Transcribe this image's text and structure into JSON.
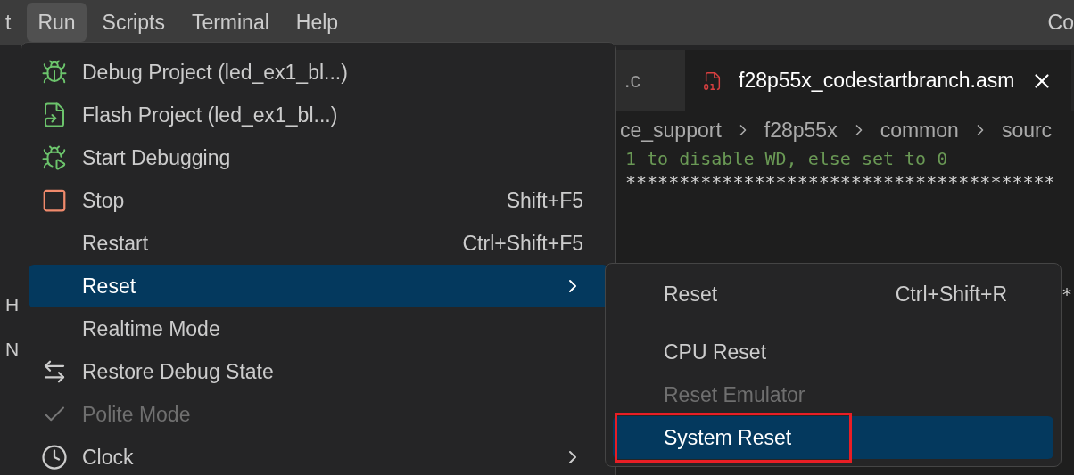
{
  "menu_bar": {
    "items": [
      {
        "label": "t",
        "selected": false
      },
      {
        "label": "Run",
        "selected": true
      },
      {
        "label": "Scripts",
        "selected": false
      },
      {
        "label": "Terminal",
        "selected": false
      },
      {
        "label": "Help",
        "selected": false
      }
    ],
    "title_fragment": "Co"
  },
  "sidebar": {
    "fragments": [
      "H",
      "N"
    ]
  },
  "tabs": [
    {
      "label": ".c",
      "selected": false
    },
    {
      "label": "f28p55x_codestartbranch.asm",
      "selected": true
    }
  ],
  "breadcrumbs": [
    "ce_support",
    "f28p55x",
    "common",
    "sourc"
  ],
  "code_lines": [
    {
      "kind": "comment",
      "text": "1 to disable WD, else set to 0"
    },
    {
      "kind": "plain",
      "text": "****************************************"
    },
    {
      "kind": "tail",
      "text": "*"
    }
  ],
  "run_menu": {
    "items": [
      {
        "label": "Debug Project (led_ex1_bl...)",
        "kind": "debug",
        "submenu": false,
        "selected": false,
        "disabled": false
      },
      {
        "label": "Flash Project (led_ex1_bl...)",
        "kind": "flash",
        "submenu": false,
        "selected": false,
        "disabled": false
      },
      {
        "label": "Start Debugging",
        "kind": "start",
        "submenu": false,
        "selected": false,
        "disabled": false
      },
      {
        "label": "Stop",
        "kind": "stop",
        "shortcut": "Shift+F5",
        "submenu": false,
        "selected": false,
        "disabled": false
      },
      {
        "label": "Restart",
        "kind": "plain",
        "shortcut": "Ctrl+Shift+F5",
        "submenu": false,
        "selected": false,
        "disabled": false
      },
      {
        "label": "Reset",
        "kind": "plain",
        "submenu": true,
        "selected": true,
        "disabled": false
      },
      {
        "label": "Realtime Mode",
        "kind": "plain",
        "submenu": false,
        "selected": false,
        "disabled": false
      },
      {
        "label": "Restore Debug State",
        "kind": "restore",
        "submenu": false,
        "selected": false,
        "disabled": false
      },
      {
        "label": "Polite Mode",
        "kind": "check",
        "submenu": false,
        "selected": false,
        "disabled": true
      },
      {
        "label": "Clock",
        "kind": "clock",
        "submenu": true,
        "selected": false,
        "disabled": false
      }
    ]
  },
  "reset_submenu": {
    "items": [
      {
        "kind": "item",
        "label": "Reset",
        "shortcut": "Ctrl+Shift+R",
        "selected": false,
        "disabled": false
      },
      {
        "kind": "separator"
      },
      {
        "kind": "item",
        "label": "CPU Reset",
        "selected": false,
        "disabled": false
      },
      {
        "kind": "item",
        "label": "Reset Emulator",
        "selected": false,
        "disabled": true
      },
      {
        "kind": "item",
        "label": "System Reset",
        "selected": true,
        "disabled": false
      }
    ]
  },
  "annotation_on_selected": true
}
